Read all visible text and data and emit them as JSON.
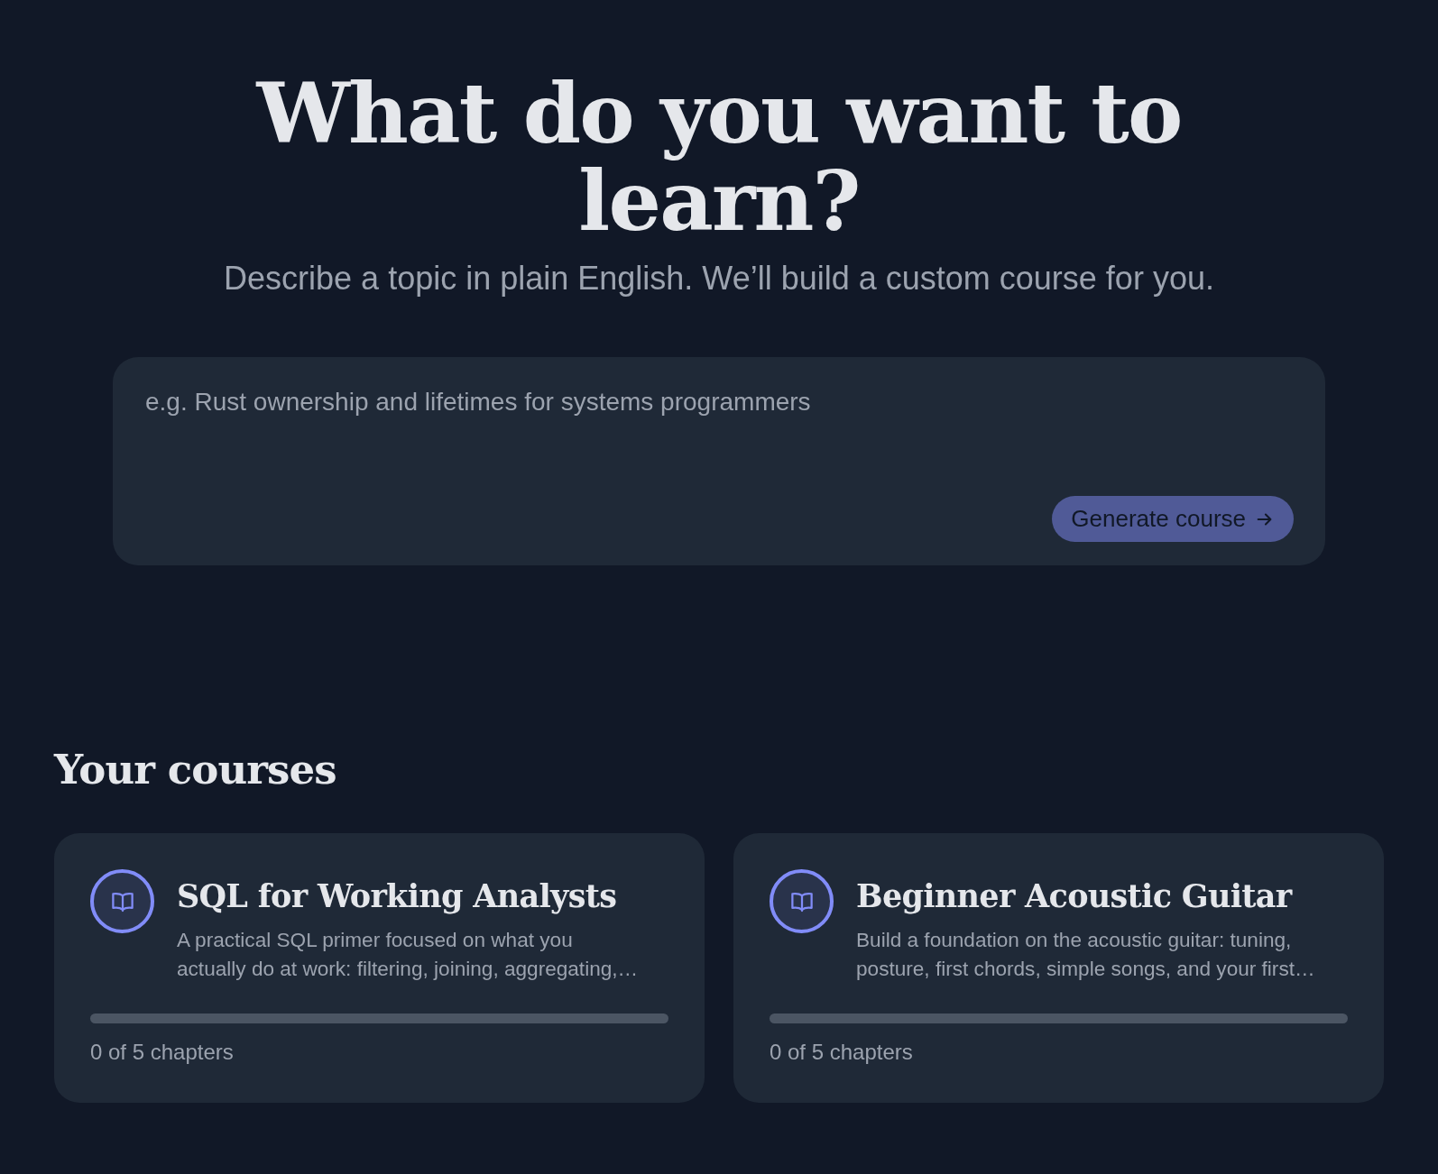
{
  "hero": {
    "title": "What do you want to learn?",
    "subtitle": "Describe a topic in plain English. We’ll build a custom course for you."
  },
  "prompt": {
    "placeholder": "e.g. Rust ownership and lifetimes for systems programmers",
    "button": "Generate course"
  },
  "courses": {
    "heading": "Your courses",
    "items": [
      {
        "title": "SQL for Working Analysts",
        "description": "A practical SQL primer focused on what you actually do at work: filtering, joining, aggregating,…",
        "level": 0,
        "progress": "0 of 5 chapters"
      },
      {
        "title": "Beginner Acoustic Guitar",
        "description": "Build a foundation on the acoustic guitar: tuning, posture, first chords, simple songs, and your first…",
        "level": 0,
        "progress": "0 of 5 chapters"
      }
    ]
  }
}
